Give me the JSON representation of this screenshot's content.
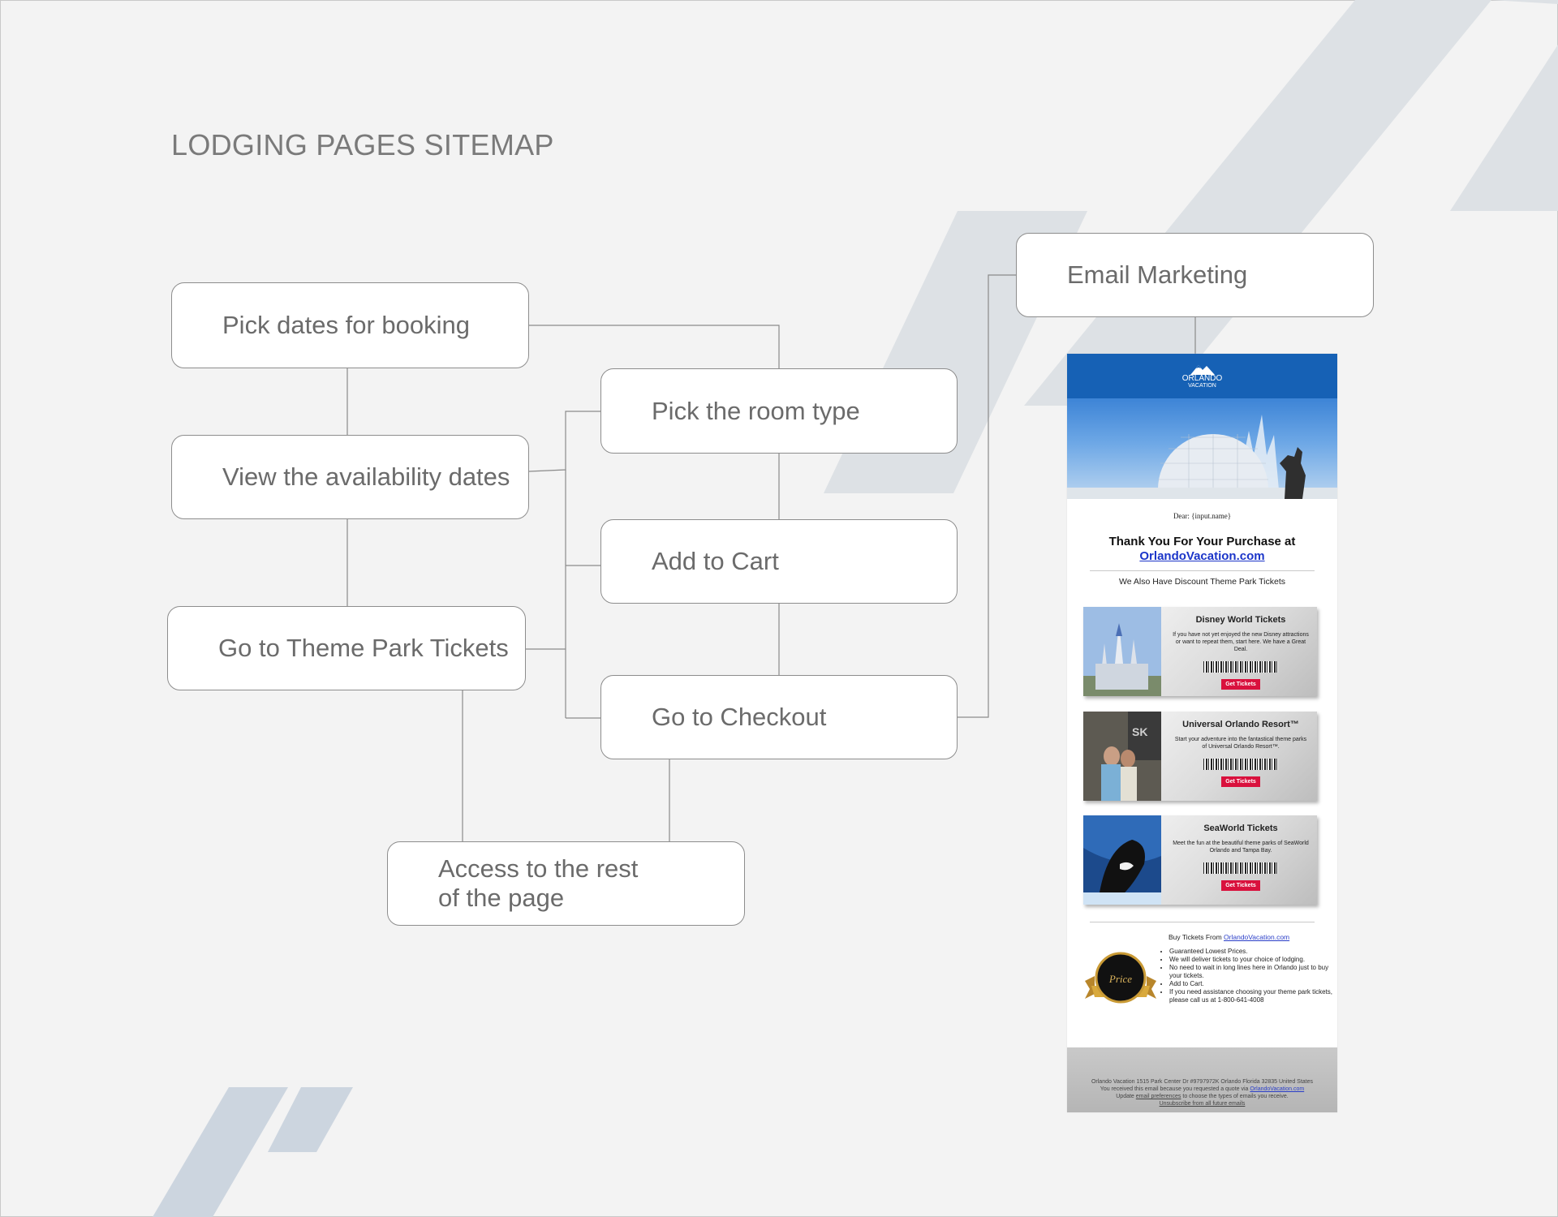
{
  "title": "LODGING PAGES SITEMAP",
  "nodes": {
    "pick_dates": "Pick dates for booking",
    "view_availability": "View the availability dates",
    "theme_park": "Go to Theme Park Tickets",
    "room_type": "Pick the room type",
    "add_to_cart": "Add to Cart",
    "checkout": "Go to Checkout",
    "access_line1": "Access to the rest",
    "access_line2": "of the page",
    "email_marketing": "Email Marketing"
  },
  "email": {
    "logo_line1": "ORLANDO",
    "logo_line2": "VACATION",
    "dear": "Dear: {input.name}",
    "thanks_line1": "Thank You For Your Purchase at",
    "thanks_link": "OrlandoVacation.com",
    "also": "We Also Have Discount Theme Park Tickets",
    "tickets": [
      {
        "title": "Disney World Tickets",
        "desc": "If you have not yet enjoyed the new Disney attractions or want to repeat them, start here. We have a Great Deal.",
        "button": "Get Tickets"
      },
      {
        "title": "Universal Orlando Resort™",
        "desc": "Start your adventure into the fantastical theme parks of Universal Orlando Resort™.",
        "button": "Get Tickets"
      },
      {
        "title": "SeaWorld Tickets",
        "desc": "Meet the fun at the beautiful theme parks of SeaWorld Orlando and Tampa Bay.",
        "button": "Get Tickets"
      }
    ],
    "buy_prefix": "Buy Tickets From",
    "buy_link": "OrlandoVacation.com",
    "bullets": [
      "Guaranteed Lowest Prices.",
      "We will deliver tickets to your choice of lodging.",
      "No need to wait in long lines here in Orlando just to buy your tickets.",
      "Add to Cart.",
      "If you need assistance choosing your theme park tickets, please call us at 1-800-641-4008"
    ],
    "seal_text": "Price",
    "footer": {
      "address": "Orlando Vacation 1515 Park Center Dr #9797972K Orlando Florida 32835 United States",
      "received_prefix": "You received this email because you requested a quote via",
      "received_link": "OrlandoVacation.com",
      "update_prefix": "Update",
      "update_link": "email preferences",
      "update_suffix": "to choose the types of emails you receive.",
      "unsubscribe": "Unsubscribe from all future emails"
    }
  },
  "colors": {
    "background": "#f3f3f3",
    "stripes": "#dde1e5",
    "stripes_dark": "#ccd5df",
    "connector": "#8a8a8a",
    "email_header": "#1661b5",
    "button": "#d9113d",
    "link": "#1b35c9"
  }
}
